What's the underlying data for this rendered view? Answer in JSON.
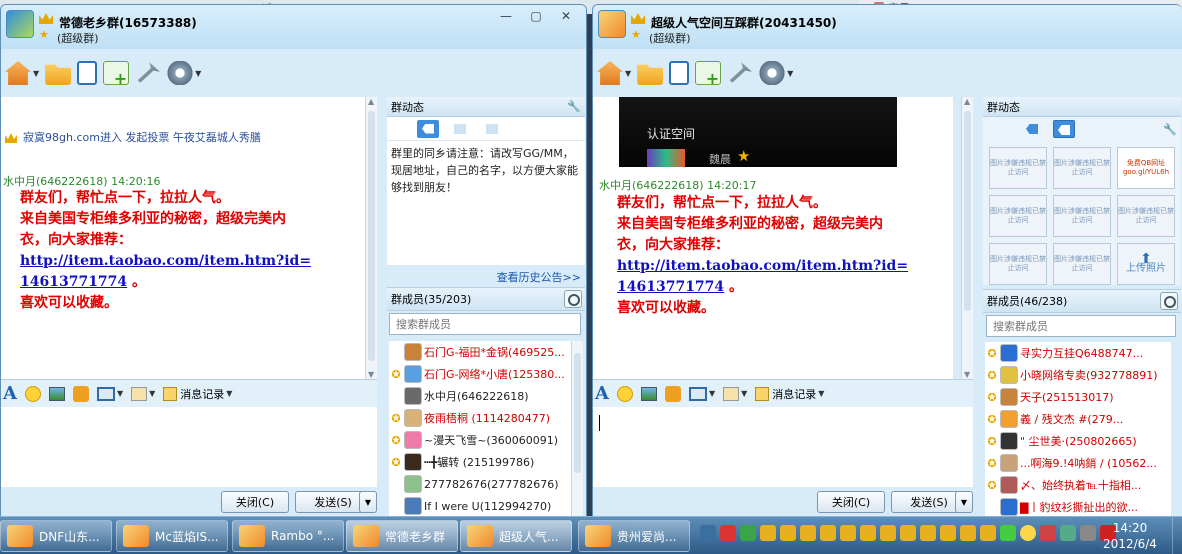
{
  "background": {
    "left_text": "话一0352-8476256",
    "right_text": "春风zcf"
  },
  "win1": {
    "title": "常德老乡群(16573388)",
    "subtitle": "(超级群)",
    "notice": "寂寞98gh.com进入 发起投票 午夜艾磊城人秀膳",
    "sender": "水中月(646222618)   14:20:16",
    "msg": {
      "line1": "群友们，帮忙点一下，拉拉人气。",
      "line2": "来自美国专柜维多利亚的秘密，超级完美内",
      "line3": "衣，向大家推荐：",
      "link1": "http://item.taobao.com/item.htm?id=",
      "link2": "14613771774",
      "link_tail": " 。",
      "line5": "喜欢可以收藏。"
    },
    "side": {
      "header": "群动态",
      "announcement": "群里的同乡请注意：请改写GG/MM，现居地址，自己的名字，以方便大家能够找到朋友！",
      "view_history": "查看历史公告>>",
      "members_header": "群成员(35/203)",
      "search_placeholder": "搜索群成员",
      "members": [
        {
          "name": "石门G-福田*金锅(469525...",
          "star": "",
          "color": "red",
          "avatar": "#c8823c"
        },
        {
          "name": "石门G-网络*小唐(125380...",
          "star": "✪",
          "color": "red",
          "avatar": "#58a0e0"
        },
        {
          "name": "水中月(646222618)",
          "star": "",
          "color": "blk",
          "avatar": "#6a6a6a"
        },
        {
          "name": "夜雨梧桐 (1114280477)",
          "star": "✪",
          "color": "red",
          "avatar": "#d9b27a"
        },
        {
          "name": "~漫天飞雪~(360060091)",
          "star": "✪",
          "color": "blk",
          "avatar": "#f07aa8"
        },
        {
          "name": "┅╋辗转 (215199786)",
          "star": "✪",
          "color": "blk",
          "avatar": "#3b2b1e"
        },
        {
          "name": "277782676(277782676)",
          "star": "",
          "color": "blk",
          "avatar": "#8cc08c"
        },
        {
          "name": "If I were U(112994270)",
          "star": "",
          "color": "blk",
          "avatar": "#4a7ab8"
        }
      ]
    },
    "inbar": {
      "history": "消息记录"
    },
    "buttons": {
      "close": "关闭(C)",
      "send": "发送(S)"
    }
  },
  "win2": {
    "title": "超级人气空间互踩群(20431450)",
    "subtitle": "(超级群)",
    "cert": {
      "label": "认证空间",
      "name": "魏晨"
    },
    "sender": "水中月(646222618)   14:20:17",
    "msg": {
      "line1": "群友们，帮忙点一下，拉拉人气。",
      "line2": "来自美国专柜维多利亚的秘密，超级完美内",
      "line3": "衣，向大家推荐：",
      "link1": "http://item.taobao.com/item.htm?id=",
      "link2": "14613771774",
      "link_tail": " 。",
      "line5": "喜欢可以收藏。"
    },
    "side": {
      "header": "群动态",
      "photos": [
        "图片涉嫌违规已禁止访问",
        "图片涉嫌违规已禁止访问",
        "免费QB网址 goo.gl/YUL6h",
        "图片涉嫌违规已禁止访问",
        "图片涉嫌违规已禁止访问",
        "图片涉嫌违规已禁止访问",
        "图片涉嫌违规已禁止访问",
        "图片涉嫌违规已禁止访问"
      ],
      "upload": "上传照片",
      "members_header": "群成员(46/238)",
      "search_placeholder": "搜索群成员",
      "members": [
        {
          "name": "寻实力互挂Q6488747...",
          "star": "✪",
          "color": "red",
          "avatar": "#2a6fd0"
        },
        {
          "name": "小晓网络专卖(932778891)",
          "star": "✪",
          "color": "red",
          "avatar": "#e0c040"
        },
        {
          "name": "天子(251513017)",
          "star": "✪",
          "color": "red",
          "avatar": "#c8823c"
        },
        {
          "name": "義 / 残文杰      #(279...",
          "star": "✪",
          "color": "red",
          "avatar": "#f0a030"
        },
        {
          "name": "\" 尘世美·(250802665)",
          "star": "✪",
          "color": "red",
          "avatar": "#333333"
        },
        {
          "name": "...啊海9.!4呐銷 / (10562...",
          "star": "✪",
          "color": "red",
          "avatar": "#c9a27a"
        },
        {
          "name": "〆、始终执着℡十指相...",
          "star": "✪",
          "color": "red",
          "avatar": "#b05a5a"
        },
        {
          "name": "▇丨豹纹衫撕扯出的欲...",
          "star": "",
          "color": "red",
          "avatar": "#2a6fd0"
        }
      ]
    },
    "inbar": {
      "history": "消息记录"
    },
    "buttons": {
      "close": "关闭(C)",
      "send": "发送(S)"
    }
  },
  "taskbar": {
    "tasks": [
      "DNF山东...",
      "Mc蓝焰IS...",
      "Rambo °...",
      "常德老乡群",
      "超级人气...",
      "贵州爱尚..."
    ],
    "clock_time": "14:20",
    "clock_date": "2012/6/4"
  },
  "colors": {
    "accent": "#3e8ddd",
    "message_red": "#e00000",
    "link_blue": "#1010c0",
    "sender_green": "#2a8a2a"
  }
}
